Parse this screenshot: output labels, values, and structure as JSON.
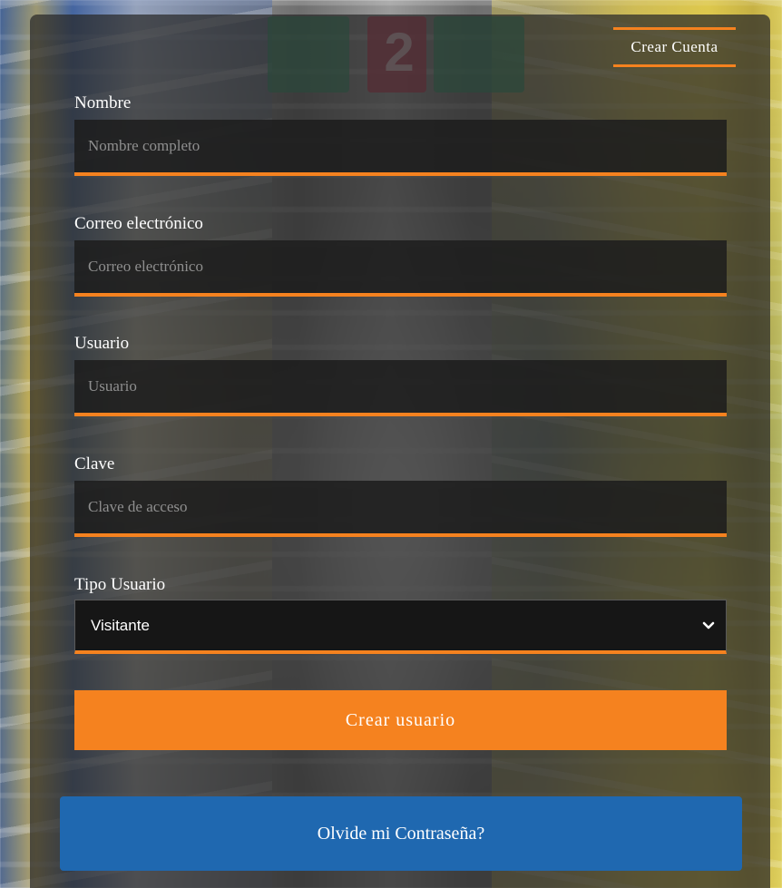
{
  "header": {
    "tab_label": "Crear Cuenta"
  },
  "form": {
    "fields": [
      {
        "label": "Nombre",
        "placeholder": "Nombre completo",
        "value": ""
      },
      {
        "label": "Correo electrónico",
        "placeholder": "Correo electrónico",
        "value": ""
      },
      {
        "label": "Usuario",
        "placeholder": "Usuario",
        "value": ""
      },
      {
        "label": "Clave",
        "placeholder": "Clave de acceso",
        "value": ""
      }
    ],
    "user_type": {
      "label": "Tipo Usuario",
      "selected": "Visitante"
    },
    "submit_label": "Crear usuario"
  },
  "forgot_password_label": "Olvide mi Contraseña?",
  "background": {
    "sign_number": "2"
  },
  "colors": {
    "accent": "#f5821f",
    "link_button": "#1f68b0",
    "panel": "#282828"
  }
}
